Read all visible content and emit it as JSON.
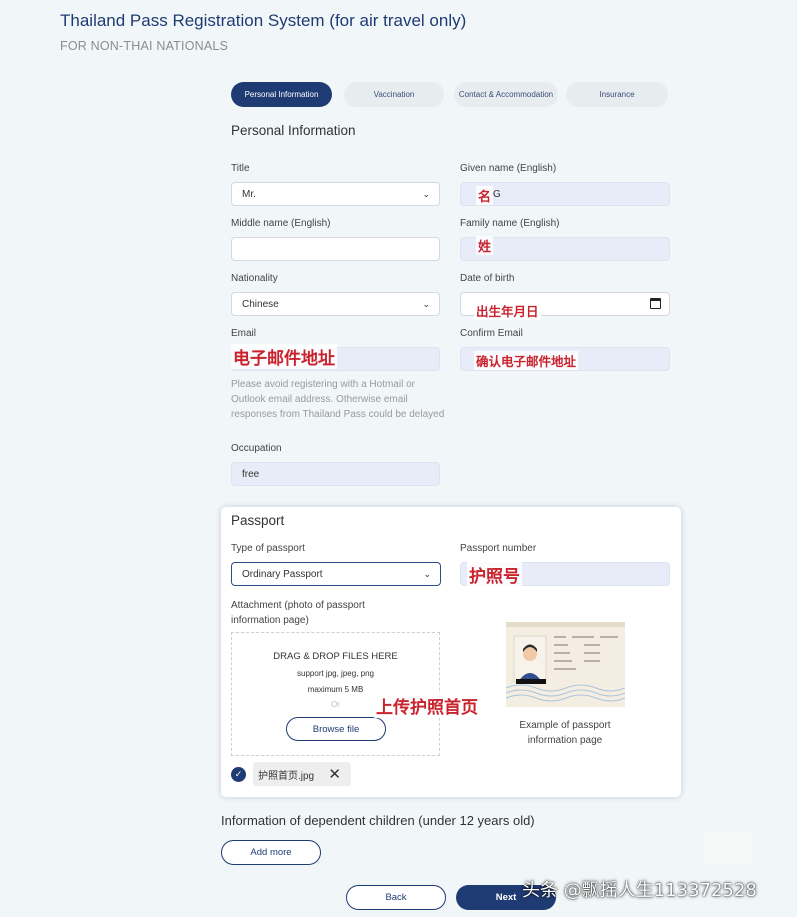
{
  "header": {
    "title": "Thailand Pass Registration System (for air travel only)",
    "subtitle": "FOR NON-THAI NATIONALS"
  },
  "steps": [
    {
      "label": "Personal Information",
      "active": true
    },
    {
      "label": "Vaccination",
      "active": false
    },
    {
      "label": "Contact & Accommodation",
      "active": false
    },
    {
      "label": "Insurance",
      "active": false
    }
  ],
  "personal": {
    "section_title": "Personal Information",
    "title_label": "Title",
    "title_value": "Mr.",
    "given_label": "Given name (English)",
    "given_value": "G",
    "middle_label": "Middle name (English)",
    "middle_value": "",
    "family_label": "Family name (English)",
    "family_value": "",
    "nationality_label": "Nationality",
    "nationality_value": "Chinese",
    "dob_label": "Date of birth",
    "dob_value": "",
    "email_label": "Email",
    "email_value": "",
    "confirm_email_label": "Confirm Email",
    "confirm_email_value": "",
    "email_hint": "Please avoid registering with a Hotmail or Outlook email address. Otherwise email responses from Thailand Pass could be delayed",
    "occupation_label": "Occupation",
    "occupation_value": "free"
  },
  "passport": {
    "section_title": "Passport",
    "type_label": "Type of passport",
    "type_value": "Ordinary Passport",
    "number_label": "Passport number",
    "number_value": "",
    "attachment_label": "Attachment (photo of passport information page)",
    "dropzone": {
      "title": "DRAG & DROP FILES HERE",
      "support": "support jpg, jpeg, png",
      "max": "maximum 5 MB",
      "or": "Or",
      "browse": "Browse file"
    },
    "file_name": "护照首页.jpg",
    "example_caption": "Example of passport information page"
  },
  "annotations": {
    "given": "名",
    "family": "姓",
    "dob": "出生年月日",
    "email": "电子邮件地址",
    "confirm_email": "确认电子邮件地址",
    "passport_number": "护照号",
    "upload": "上传护照首页"
  },
  "children": {
    "title": "Information of dependent children (under 12 years old)",
    "add_more": "Add more"
  },
  "nav": {
    "back": "Back",
    "next": "Next"
  },
  "watermark": "头条 @飘摇人生113372528",
  "colors": {
    "primary": "#1f3b73",
    "background": "#f1f6f9",
    "filled_field": "#e7ecf8",
    "annotation_red": "#c9232e"
  }
}
